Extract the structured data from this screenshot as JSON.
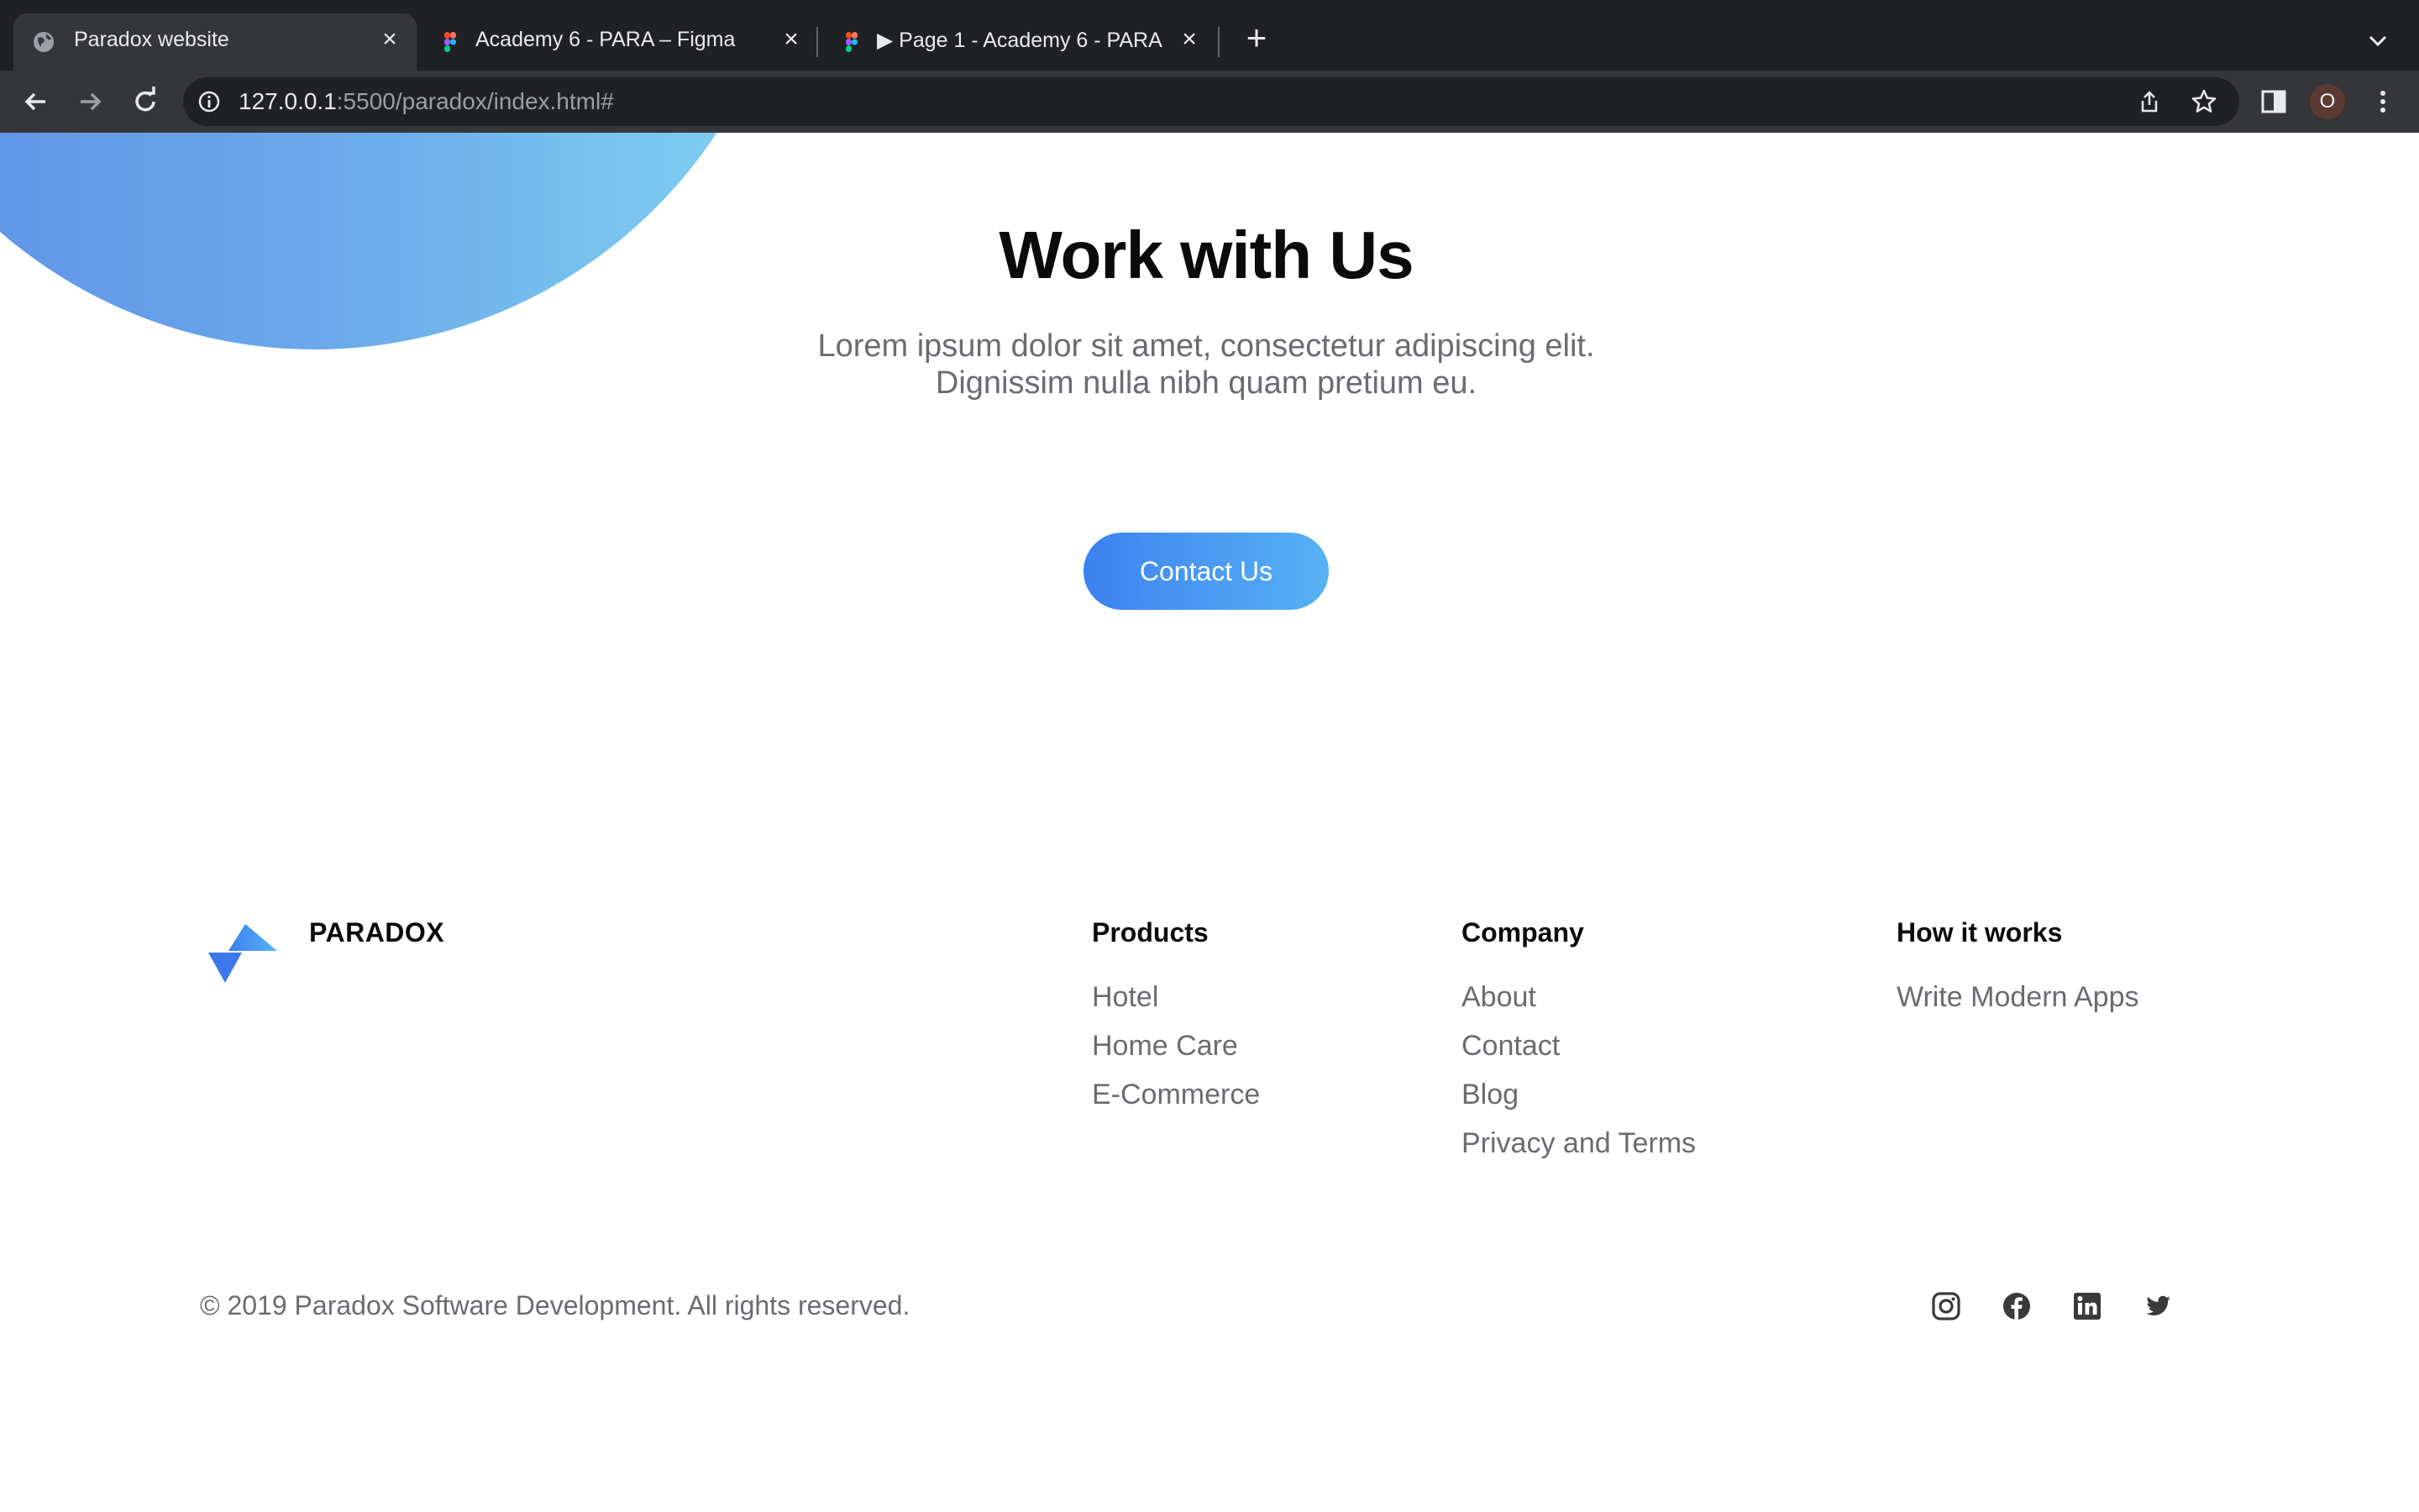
{
  "browser": {
    "tabs": [
      {
        "title": "Paradox website",
        "active": true,
        "favicon": "globe-icon"
      },
      {
        "title": "Academy 6 - PARA – Figma",
        "active": false,
        "favicon": "figma-icon"
      },
      {
        "title": "▶ Page 1 - Academy 6 - PARA",
        "active": false,
        "favicon": "figma-icon"
      }
    ],
    "new_tab": "+",
    "url_host": "127.0.0.1",
    "url_rest": ":5500/paradox/index.html#",
    "profile_initial": "O"
  },
  "hero": {
    "title": "Work with Us",
    "subtitle_line1": "Lorem ipsum dolor sit amet, consectetur adipiscing elit.",
    "subtitle_line2": "Dignissim nulla nibh quam pretium eu.",
    "cta": "Contact Us"
  },
  "footer": {
    "brand": "PARADOX",
    "columns": [
      {
        "heading": "Products",
        "links": [
          "Hotel",
          "Home Care",
          "E-Commerce"
        ]
      },
      {
        "heading": "Company",
        "links": [
          "About",
          "Contact",
          "Blog",
          "Privacy and Terms"
        ]
      },
      {
        "heading": "How it works",
        "links": [
          "Write Modern Apps"
        ]
      }
    ],
    "copyright": "© 2019 Paradox Software Development. All rights reserved.",
    "social": [
      "instagram-icon",
      "facebook-icon",
      "linkedin-icon",
      "twitter-icon"
    ]
  },
  "colors": {
    "accent_start": "#3c82f0",
    "accent_end": "#58b2f4",
    "text_muted": "#6b6b73",
    "chrome_dark": "#202124"
  }
}
